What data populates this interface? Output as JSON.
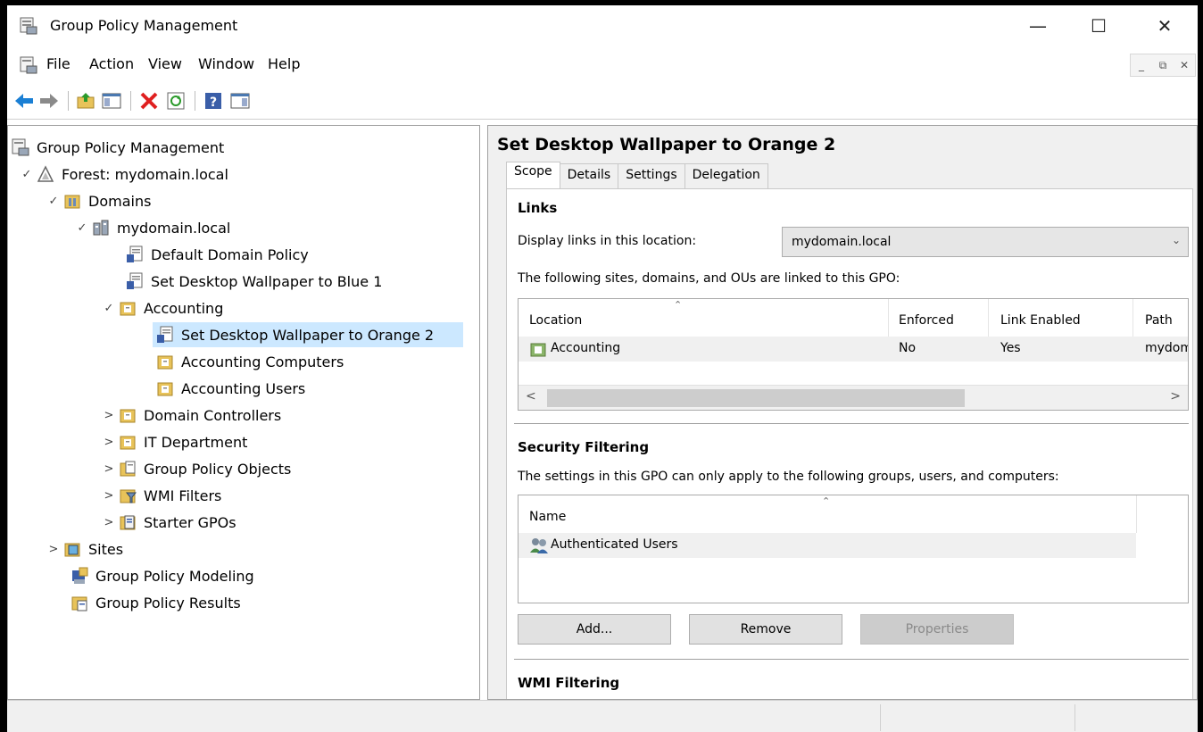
{
  "window": {
    "title": "Group Policy Management"
  },
  "menu": [
    "File",
    "Action",
    "View",
    "Window",
    "Help"
  ],
  "tree": {
    "root": "Group Policy Management",
    "forest": "Forest: mydomain.local",
    "domains": "Domains",
    "domain": "mydomain.local",
    "items": {
      "default_domain_policy": "Default Domain Policy",
      "wallpaper_blue": "Set Desktop Wallpaper to Blue 1",
      "accounting": "Accounting",
      "wallpaper_orange": "Set Desktop Wallpaper to Orange 2",
      "accounting_computers": "Accounting Computers",
      "accounting_users": "Accounting Users",
      "domain_controllers": "Domain Controllers",
      "it_department": "IT Department",
      "gpo_objects": "Group Policy Objects",
      "wmi_filters": "WMI Filters",
      "starter_gpos": "Starter GPOs",
      "sites": "Sites",
      "modeling": "Group Policy Modeling",
      "results": "Group Policy Results"
    }
  },
  "detail": {
    "title": "Set Desktop Wallpaper to Orange 2",
    "tabs": [
      "Scope",
      "Details",
      "Settings",
      "Delegation"
    ],
    "links": {
      "heading": "Links",
      "display_label": "Display links in this location:",
      "location_value": "mydomain.local",
      "desc": "The following sites, domains, and OUs are linked to this GPO:",
      "columns": [
        "Location",
        "Enforced",
        "Link Enabled",
        "Path"
      ],
      "rows": [
        {
          "location": "Accounting",
          "enforced": "No",
          "link_enabled": "Yes",
          "path": "mydom"
        }
      ]
    },
    "security": {
      "heading": "Security Filtering",
      "desc": "The settings in this GPO can only apply to the following groups, users, and computers:",
      "column": "Name",
      "rows": [
        "Authenticated Users"
      ],
      "buttons": {
        "add": "Add...",
        "remove": "Remove",
        "properties": "Properties"
      }
    },
    "wmi": {
      "heading": "WMI Filtering"
    }
  },
  "colors": {
    "selection": "#cce8ff",
    "back_arrow": "#1a7fd4",
    "delete": "#e02020"
  }
}
